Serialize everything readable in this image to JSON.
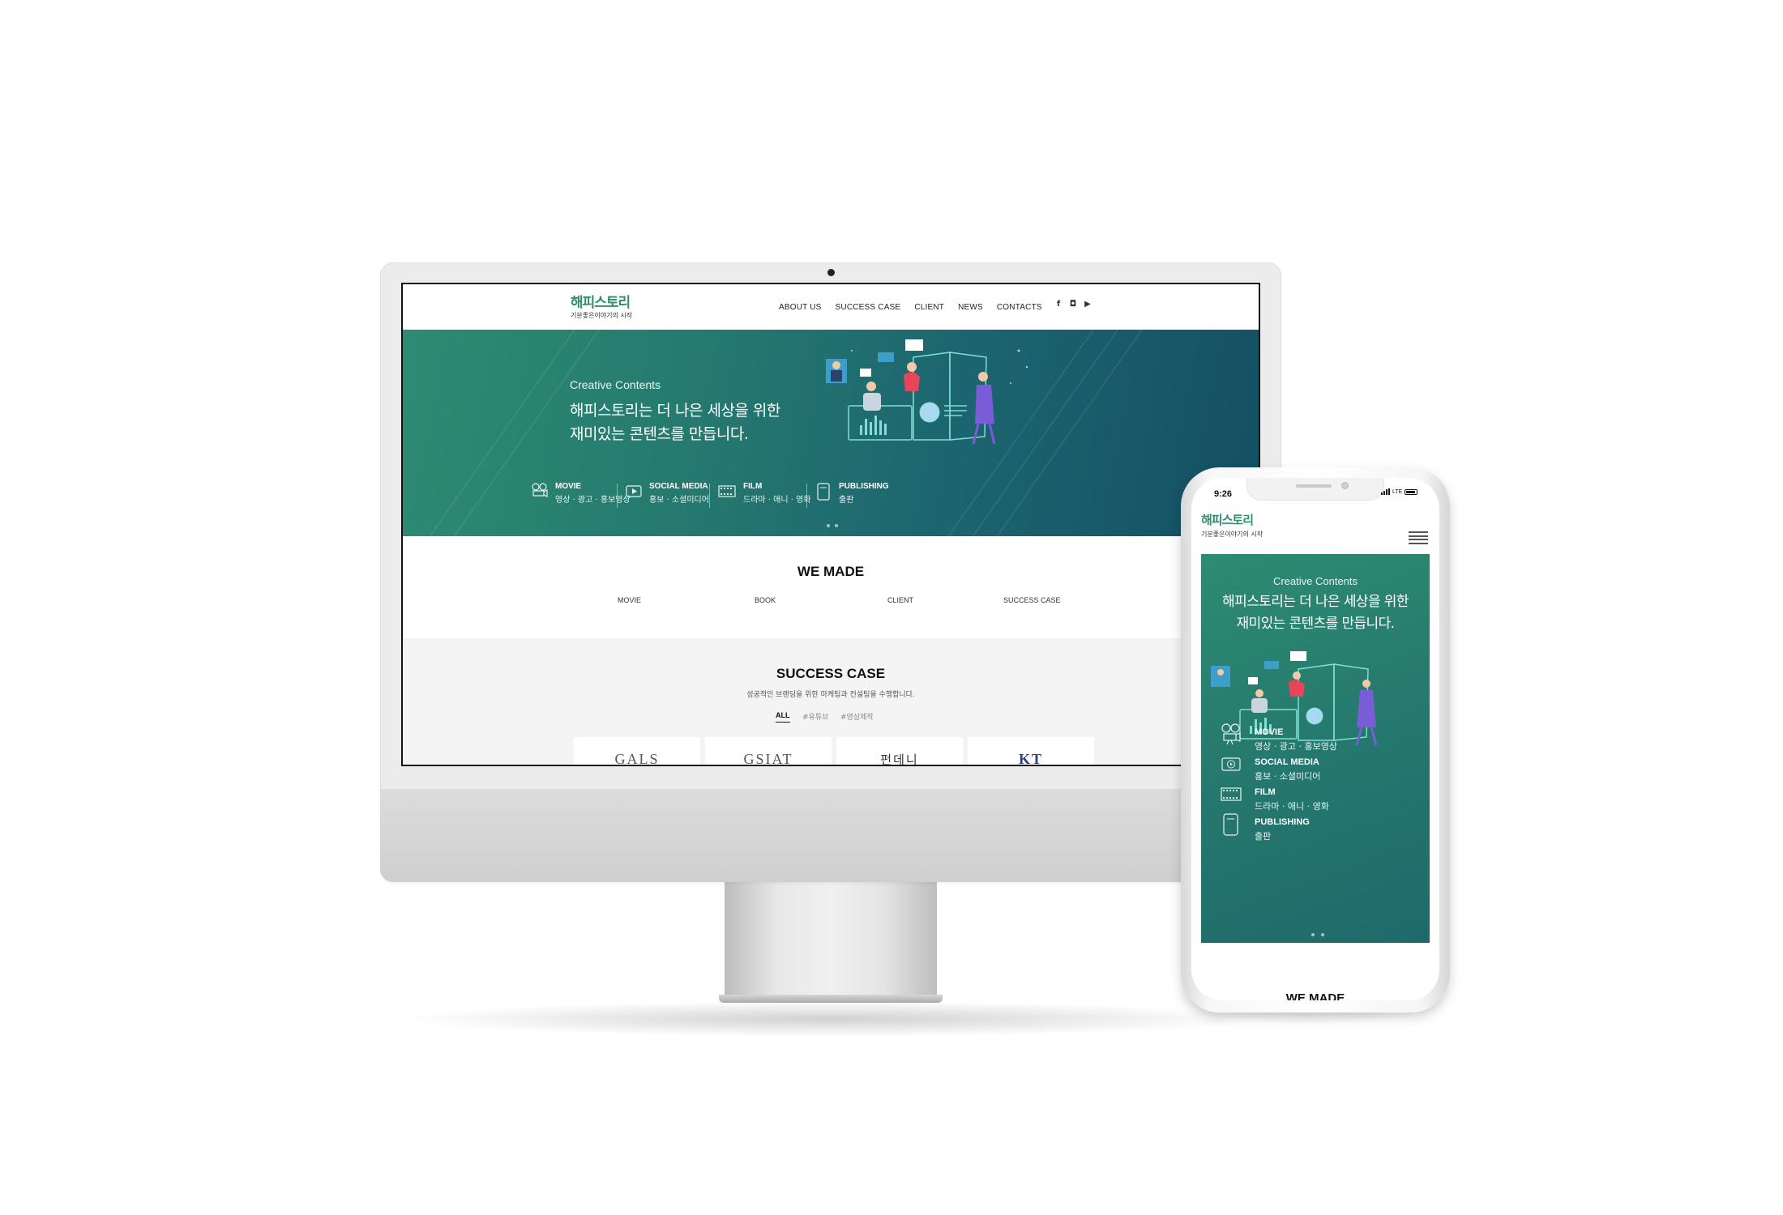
{
  "brand": {
    "logo_text": "해피스토리",
    "tagline": "기분좋은이야기의 시작",
    "brand_color": "#2d8f6c"
  },
  "desktop": {
    "nav": {
      "items": [
        {
          "label": "ABOUT US"
        },
        {
          "label": "SUCCESS CASE"
        },
        {
          "label": "CLIENT"
        },
        {
          "label": "NEWS"
        },
        {
          "label": "CONTACTS"
        }
      ],
      "social": [
        {
          "icon": "facebook-icon",
          "glyph": "f"
        },
        {
          "icon": "instagram-icon",
          "glyph": "◘"
        },
        {
          "icon": "youtube-icon",
          "glyph": "▶"
        }
      ]
    },
    "hero": {
      "kicker": "Creative Contents",
      "title_line1": "해피스토리는 더 나은 세상을 위한",
      "title_line2": "재미있는 콘텐츠를 만듭니다.",
      "services": [
        {
          "title": "MOVIE",
          "desc": "영상 · 광고 · 홍보영상",
          "icon": "film-camera-icon"
        },
        {
          "title": "SOCIAL MEDIA",
          "desc": "홍보 · 소셜미디어",
          "icon": "play-icon"
        },
        {
          "title": "FILM",
          "desc": "드라마 · 애니 · 영화",
          "icon": "film-strip-icon"
        },
        {
          "title": "PUBLISHING",
          "desc": "출판",
          "icon": "book-icon"
        }
      ],
      "gradient": [
        "#2e8b72",
        "#144f62"
      ]
    },
    "we_made": {
      "title": "WE MADE",
      "tabs": [
        "MOVIE",
        "BOOK",
        "CLIENT",
        "SUCCESS CASE"
      ]
    },
    "success_case": {
      "title": "SUCCESS CASE",
      "subtitle": "성공적인 브랜딩을 위한 마케팅과 컨설팅을 수행합니다.",
      "filters": [
        "ALL",
        "#유튜브",
        "#영상제작"
      ],
      "active_filter": "ALL",
      "cards": [
        "GALS",
        "GSIAT",
        "펀데니",
        "KT"
      ]
    }
  },
  "mobile": {
    "status": {
      "time": "9:26",
      "network": "LTE"
    },
    "hero": {
      "kicker": "Creative Contents",
      "title_line1": "해피스토리는 더 나은 세상을 위한",
      "title_line2": "재미있는 콘텐츠를 만듭니다.",
      "services": [
        {
          "title": "MOVIE",
          "desc": "영상 · 광고 · 홍보영상",
          "icon": "film-camera-icon"
        },
        {
          "title": "SOCIAL MEDIA",
          "desc": "홍보 · 소셜미디어",
          "icon": "play-icon"
        },
        {
          "title": "FILM",
          "desc": "드라마 · 애니 · 영화",
          "icon": "film-strip-icon"
        },
        {
          "title": "PUBLISHING",
          "desc": "출판",
          "icon": "book-icon"
        }
      ]
    },
    "next_section_title": "WE MADE"
  }
}
